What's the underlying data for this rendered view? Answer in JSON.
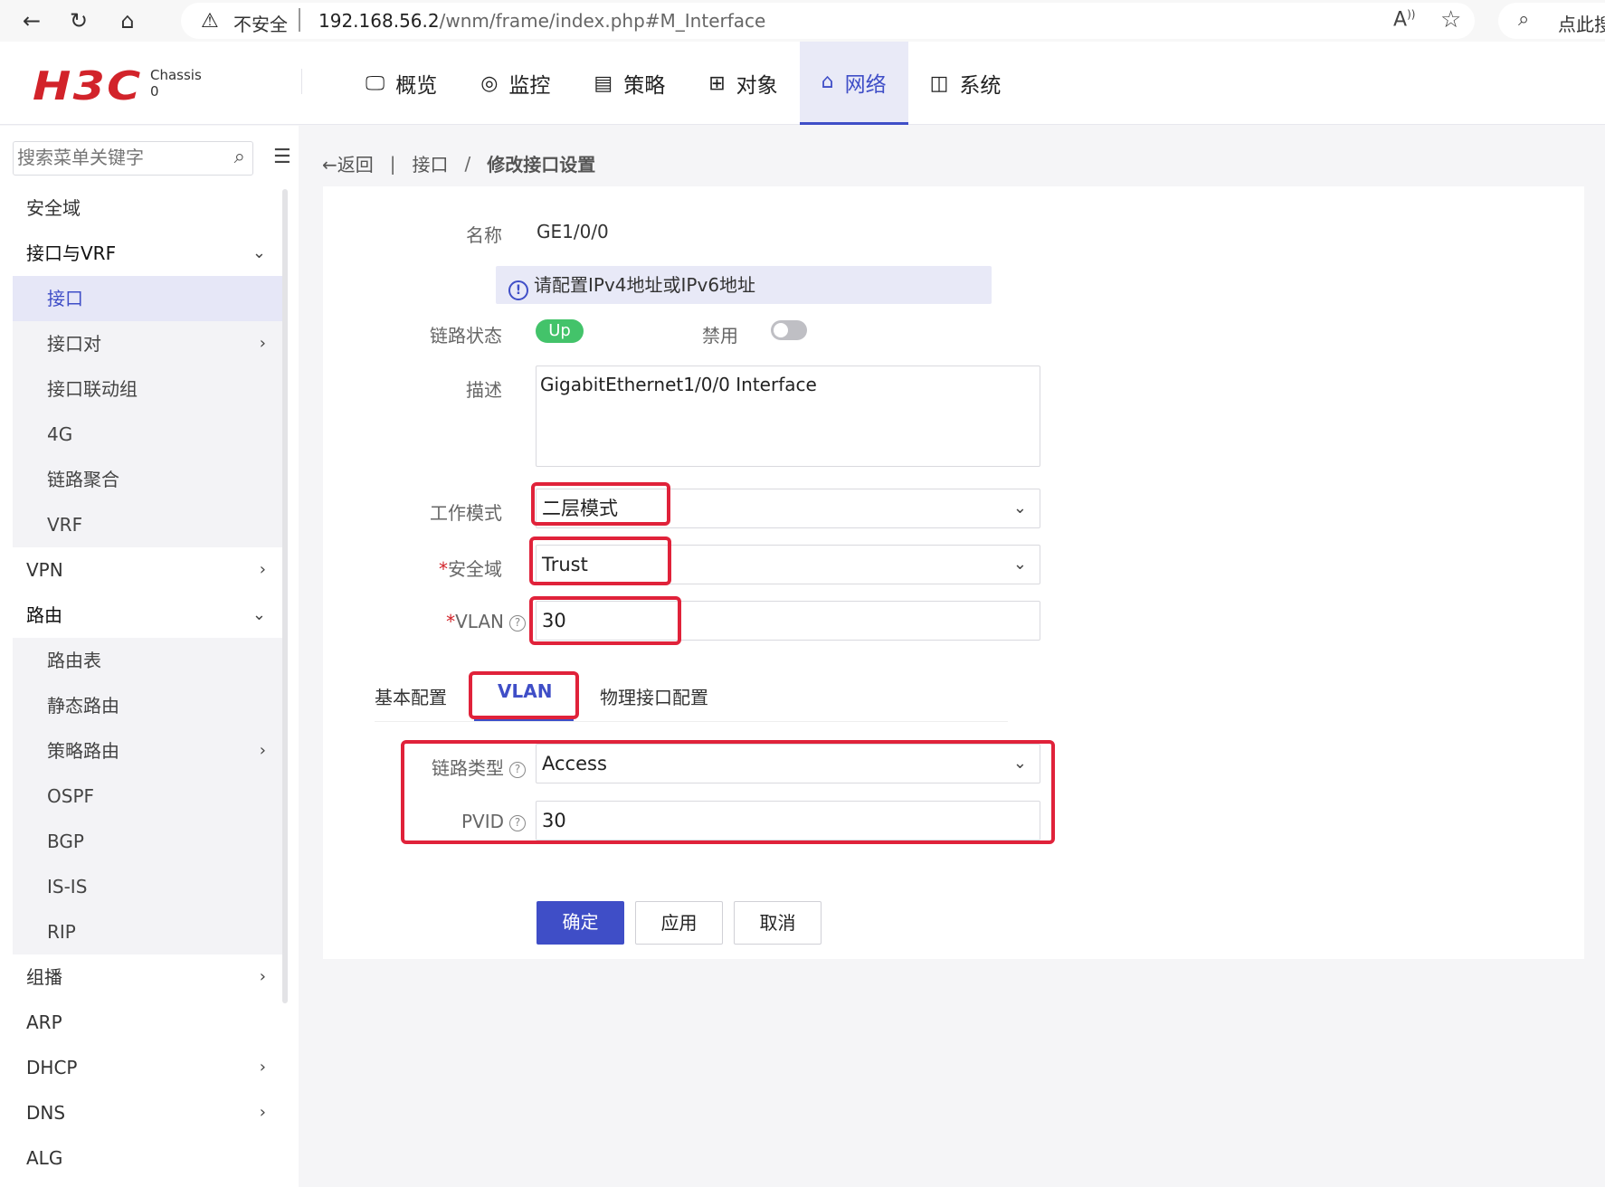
{
  "browser": {
    "insecure_label": "不安全",
    "url_host": "192.168.56.2",
    "url_path": "/wnm/frame/index.php#M_Interface",
    "search_text": "点此搜"
  },
  "header": {
    "logo": "H3C",
    "chassis_label": "Chassis",
    "chassis_value": "0",
    "nav": [
      {
        "label": "概览",
        "icon": "monitor-icon"
      },
      {
        "label": "监控",
        "icon": "target-icon"
      },
      {
        "label": "策略",
        "icon": "clipboard-icon"
      },
      {
        "label": "对象",
        "icon": "grid-icon"
      },
      {
        "label": "网络",
        "icon": "network-icon",
        "active": true
      },
      {
        "label": "系统",
        "icon": "system-icon"
      }
    ]
  },
  "sidebar": {
    "search_placeholder": "搜索菜单关键字",
    "items": [
      {
        "label": "安全域"
      },
      {
        "label": "接口与VRF",
        "chevron": "down"
      },
      {
        "label": "接口",
        "sub": true,
        "selected": true
      },
      {
        "label": "接口对",
        "sub": true,
        "chevron": "right"
      },
      {
        "label": "接口联动组",
        "sub": true
      },
      {
        "label": "4G",
        "sub": true
      },
      {
        "label": "链路聚合",
        "sub": true
      },
      {
        "label": "VRF",
        "sub": true
      },
      {
        "label": "VPN",
        "chevron": "right"
      },
      {
        "label": "路由",
        "chevron": "down"
      },
      {
        "label": "路由表",
        "sub": true
      },
      {
        "label": "静态路由",
        "sub": true
      },
      {
        "label": "策略路由",
        "sub": true,
        "chevron": "right"
      },
      {
        "label": "OSPF",
        "sub": true
      },
      {
        "label": "BGP",
        "sub": true
      },
      {
        "label": "IS-IS",
        "sub": true
      },
      {
        "label": "RIP",
        "sub": true
      },
      {
        "label": "组播",
        "chevron": "right"
      },
      {
        "label": "ARP"
      },
      {
        "label": "DHCP",
        "chevron": "right"
      },
      {
        "label": "DNS",
        "chevron": "right"
      },
      {
        "label": "ALG"
      }
    ]
  },
  "breadcrumb": {
    "back": "←返回",
    "sep1": "|",
    "parent": "接口",
    "sep2": "/",
    "current": "修改接口设置"
  },
  "form": {
    "name_label": "名称",
    "name_value": "GE1/0/0",
    "notice": "请配置IPv4地址或IPv6地址",
    "link_status_label": "链路状态",
    "link_status_value": "Up",
    "disable_label": "禁用",
    "description_label": "描述",
    "description_value": "GigabitEthernet1/0/0 Interface",
    "work_mode_label": "工作模式",
    "work_mode_value": "二层模式",
    "security_zone_label": "安全域",
    "security_zone_value": "Trust",
    "vlan_label": "VLAN",
    "vlan_value": "30",
    "link_type_label": "链路类型",
    "link_type_value": "Access",
    "pvid_label": "PVID",
    "pvid_value": "30"
  },
  "tabs": [
    {
      "label": "基本配置"
    },
    {
      "label": "VLAN",
      "active": true
    },
    {
      "label": "物理接口配置"
    }
  ],
  "buttons": {
    "ok": "确定",
    "apply": "应用",
    "cancel": "取消"
  },
  "colors": {
    "accent": "#3f4ec7",
    "brand": "#d2232a",
    "status_up": "#43c36a",
    "highlight": "#e0223a"
  }
}
